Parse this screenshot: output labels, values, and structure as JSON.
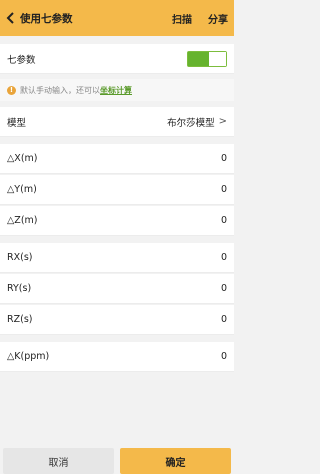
{
  "header": {
    "title": "使用七参数",
    "scan_label": "扫描",
    "share_label": "分享"
  },
  "enable_row": {
    "label": "七参数",
    "toggle_on": true
  },
  "hint": {
    "text": "默认手动输入，还可以",
    "link": "坐标计算"
  },
  "model_row": {
    "label": "模型",
    "value": "布尔莎模型",
    "chevron": ">"
  },
  "params": [
    {
      "label": "△X(m)",
      "value": "0"
    },
    {
      "label": "△Y(m)",
      "value": "0"
    },
    {
      "label": "△Z(m)",
      "value": "0"
    },
    {
      "label": "RX(s)",
      "value": "0"
    },
    {
      "label": "RY(s)",
      "value": "0"
    },
    {
      "label": "RZ(s)",
      "value": "0"
    },
    {
      "label": "△K(ppm)",
      "value": "0"
    }
  ],
  "footer": {
    "cancel_label": "取消",
    "ok_label": "确定"
  },
  "colors": {
    "accent": "#f4b94a",
    "toggle_green": "#66b32e",
    "link_green": "#5a9a2a"
  },
  "icons": {
    "back": "chevron-left-icon",
    "info": "info-icon"
  }
}
